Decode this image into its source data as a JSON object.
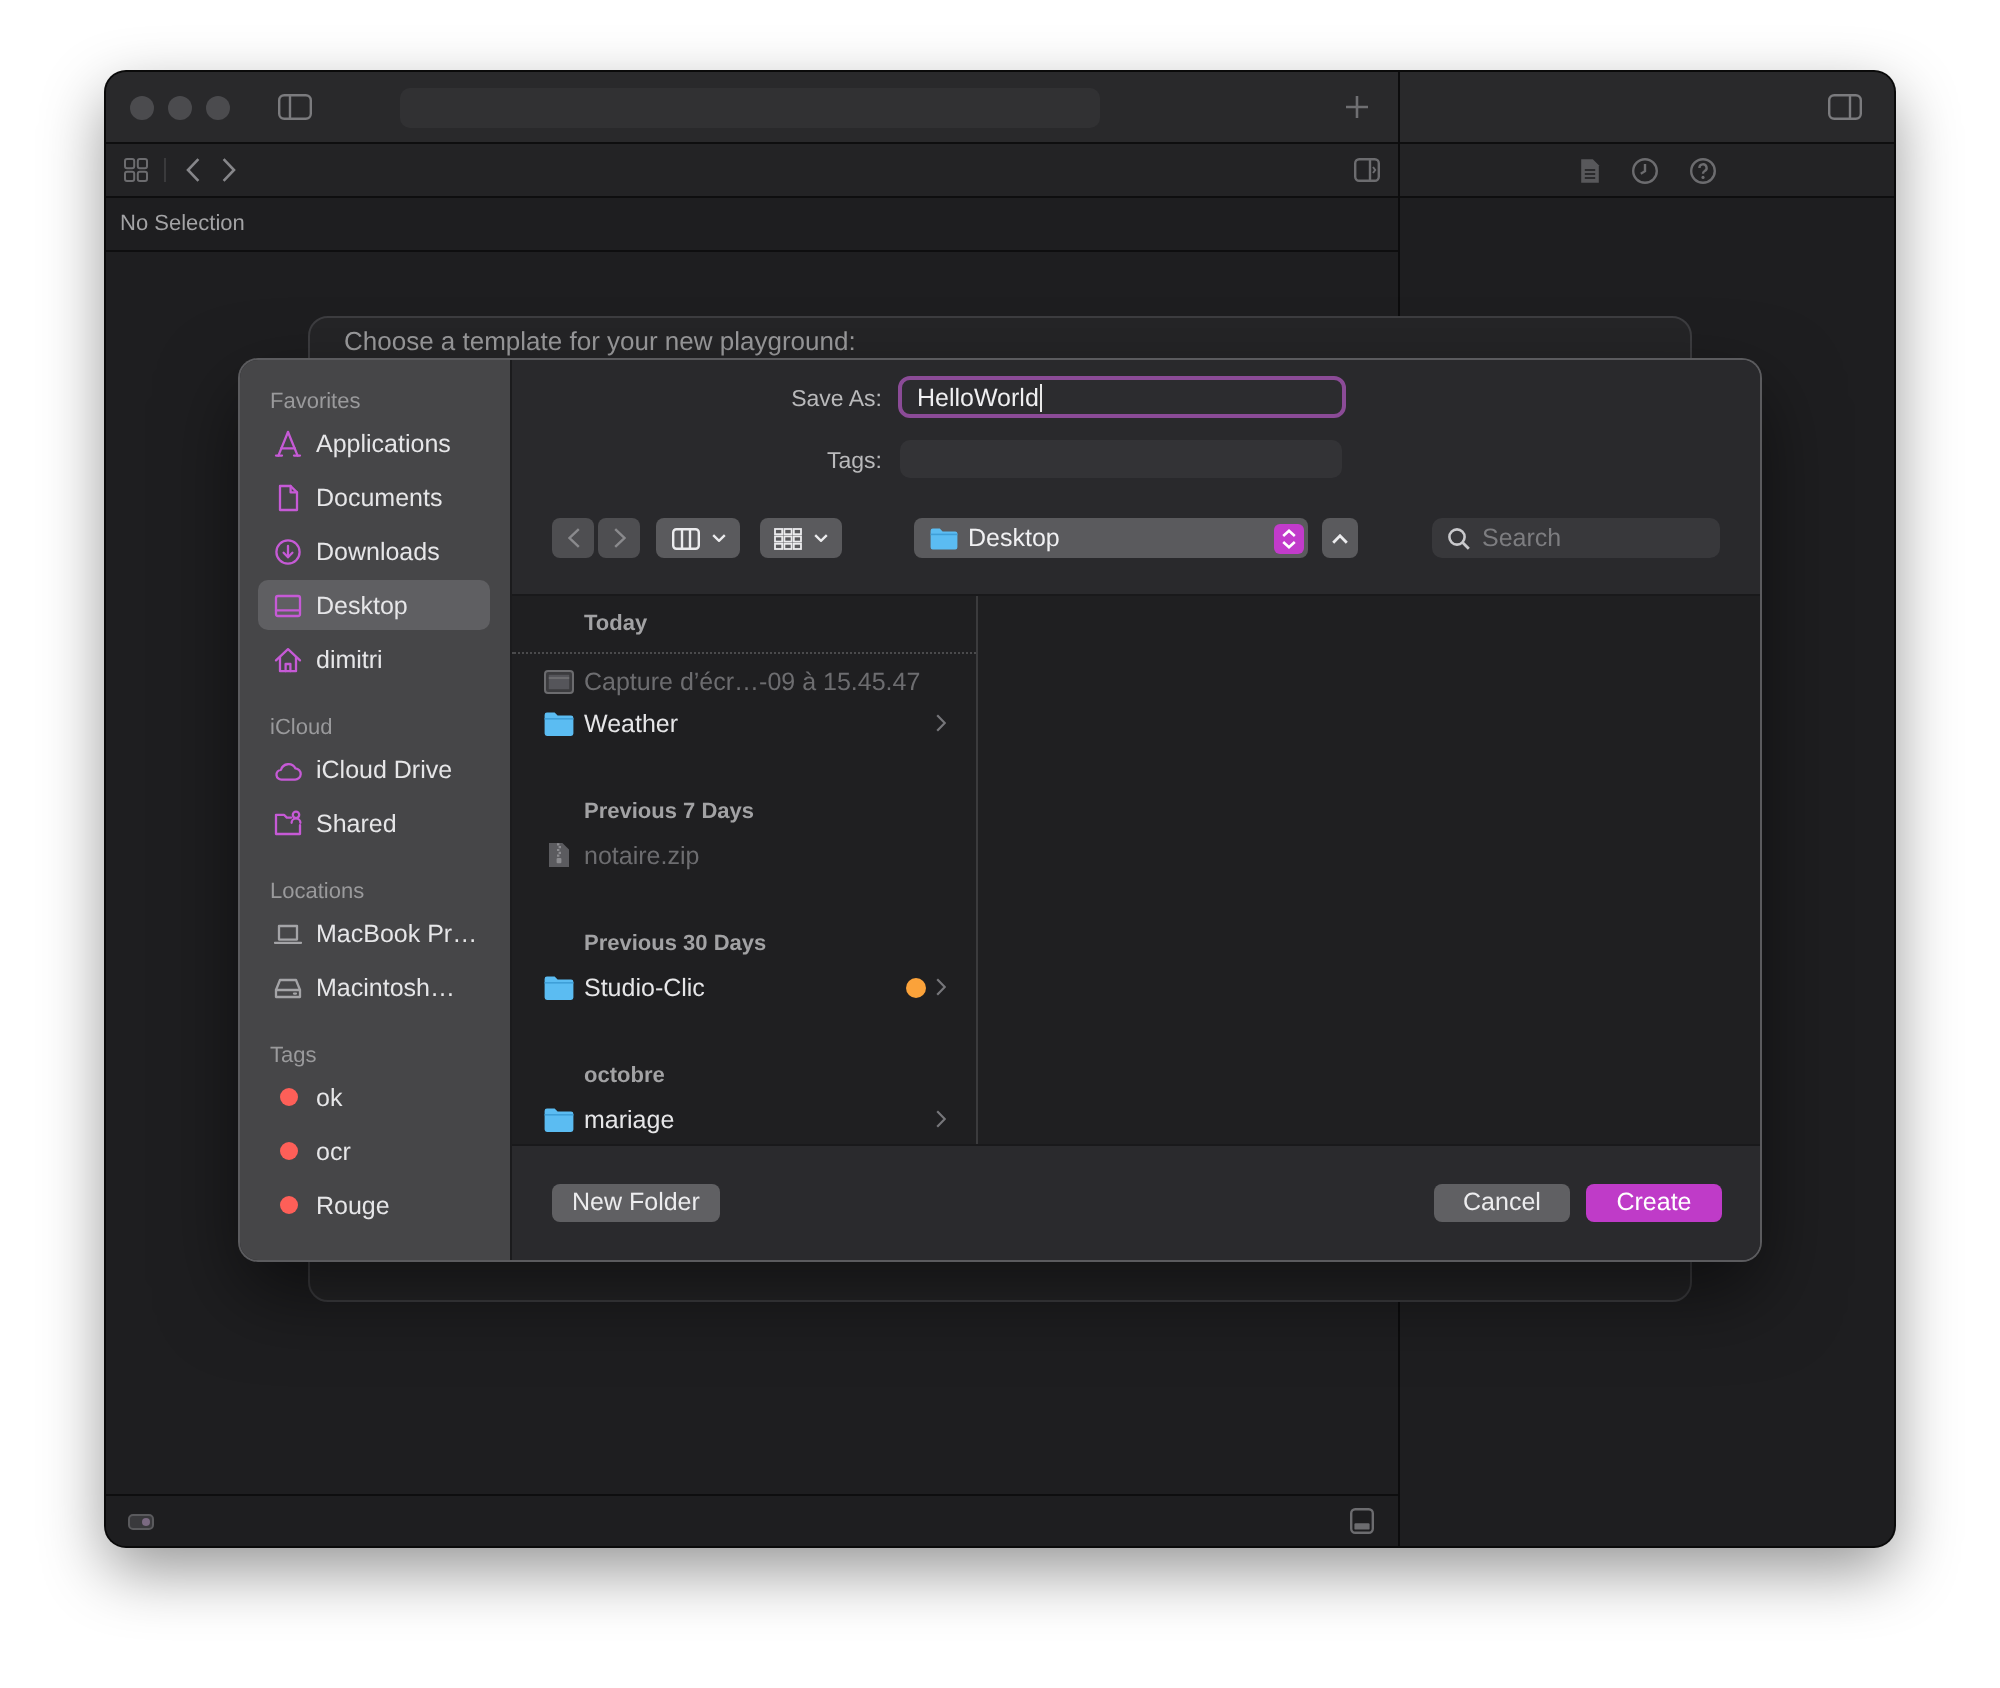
{
  "xcode": {
    "navigator_title": "No Selection"
  },
  "template_sheet": {
    "prompt": "Choose a template for your new playground:"
  },
  "save_panel": {
    "sidebar": [
      {
        "title": "Favorites",
        "items": [
          {
            "label": "Applications",
            "selected": false
          },
          {
            "label": "Documents",
            "selected": false
          },
          {
            "label": "Downloads",
            "selected": false
          },
          {
            "label": "Desktop",
            "selected": true
          },
          {
            "label": "dimitri",
            "selected": false
          }
        ]
      },
      {
        "title": "iCloud",
        "items": [
          {
            "label": "iCloud Drive",
            "selected": false
          },
          {
            "label": "Shared",
            "selected": false
          }
        ]
      },
      {
        "title": "Locations",
        "items": [
          {
            "label": "MacBook Pr…",
            "selected": false
          },
          {
            "label": "Macintosh…",
            "selected": false
          }
        ]
      },
      {
        "title": "Tags",
        "items": [
          {
            "label": "ok",
            "selected": false,
            "color": "#fe5f58"
          },
          {
            "label": "ocr",
            "selected": false,
            "color": "#fe5f58"
          },
          {
            "label": "Rouge",
            "selected": false,
            "color": "#fe5f58"
          }
        ]
      }
    ],
    "save_as": {
      "label": "Save As:",
      "value": "HelloWorld",
      "focused": true
    },
    "tags_field": {
      "label": "Tags:"
    },
    "location": {
      "value": "Desktop"
    },
    "search": {
      "placeholder": "Search"
    },
    "file_groups": [
      {
        "title": "Today",
        "items": [
          {
            "name": "Capture d’écr…-09 à 15.45.47",
            "kind": "image",
            "disabled": true
          },
          {
            "name": "Weather",
            "kind": "folder",
            "disabled": false
          }
        ]
      },
      {
        "title": "Previous 7 Days",
        "items": [
          {
            "name": "notaire.zip",
            "kind": "archive",
            "disabled": true
          }
        ]
      },
      {
        "title": "Previous 30 Days",
        "items": [
          {
            "name": "Studio-Clic",
            "kind": "folder",
            "disabled": false,
            "color": "#fba23a"
          }
        ]
      },
      {
        "title": "octobre",
        "items": [
          {
            "name": "mariage",
            "kind": "folder",
            "disabled": false
          }
        ]
      }
    ],
    "new_folder_button": {
      "label": "New Folder"
    },
    "buttons": [
      {
        "label": "Cancel",
        "kind": "default"
      },
      {
        "label": "Create",
        "kind": "primary"
      }
    ]
  }
}
